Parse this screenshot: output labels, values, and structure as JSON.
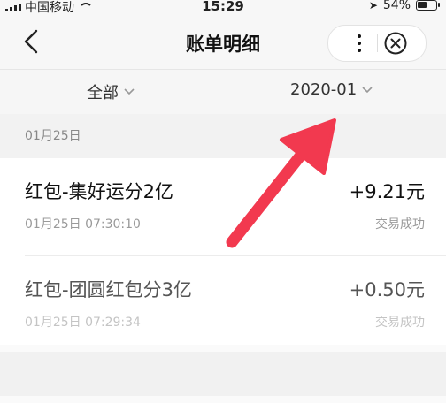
{
  "status_bar": {
    "carrier": "中国移动",
    "time": "15:29",
    "battery": "54%"
  },
  "nav": {
    "title": "账单明细"
  },
  "filters": {
    "category": "全部",
    "month": "2020-01"
  },
  "date_group": "01月25日",
  "transactions": [
    {
      "title": "红包-集好运分2亿",
      "time": "01月25日 07:30:10",
      "amount": "+9.21元",
      "status": "交易成功"
    },
    {
      "title": "红包-团圆红包分3亿",
      "time": "01月25日 07:29:34",
      "amount": "+0.50元",
      "status": "交易成功"
    }
  ],
  "colors": {
    "accent": "#f2394f",
    "text": "#111111",
    "muted": "#9a9a9a"
  },
  "icons": [
    "back-icon",
    "more-icon",
    "close-icon",
    "chevron-down-icon",
    "wifi-icon",
    "location-icon",
    "battery-icon"
  ]
}
